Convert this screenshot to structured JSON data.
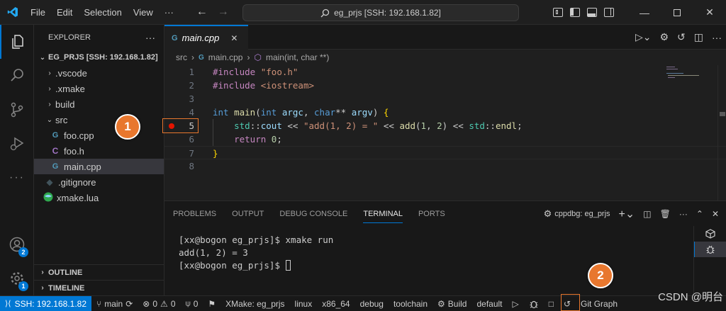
{
  "titlebar": {
    "menus": [
      "File",
      "Edit",
      "Selection",
      "View",
      "···"
    ],
    "command_center": "eg_prjs [SSH: 192.168.1.82]"
  },
  "activity": {
    "accounts_badge": "2",
    "manage_badge": "1"
  },
  "explorer": {
    "title": "EXPLORER",
    "root": "EG_PRJS [SSH: 192.168.1.82]",
    "items": [
      {
        "label": ".vscode",
        "type": "folder"
      },
      {
        "label": ".xmake",
        "type": "folder"
      },
      {
        "label": "build",
        "type": "folder"
      },
      {
        "label": "src",
        "type": "folder-open"
      },
      {
        "label": "foo.cpp",
        "type": "cpp"
      },
      {
        "label": "foo.h",
        "type": "h"
      },
      {
        "label": "main.cpp",
        "type": "cpp"
      },
      {
        "label": ".gitignore",
        "type": "git"
      },
      {
        "label": "xmake.lua",
        "type": "lua"
      }
    ],
    "outline": "OUTLINE",
    "timeline": "TIMELINE"
  },
  "editor": {
    "tab": "main.cpp",
    "breadcrumb": [
      "src",
      "main.cpp",
      "main(int, char **)"
    ],
    "line_numbers": [
      "1",
      "2",
      "3",
      "4",
      "5",
      "6",
      "7",
      "8"
    ],
    "breakpoint_line": "5"
  },
  "panel": {
    "tabs": [
      "PROBLEMS",
      "OUTPUT",
      "DEBUG CONSOLE",
      "TERMINAL",
      "PORTS"
    ],
    "active_tab": "TERMINAL",
    "terminal_name": "cppdbg: eg_prjs",
    "terminal_lines": [
      "[xx@bogon eg_prjs]$ xmake run",
      "add(1, 2) = 3",
      "[xx@bogon eg_prjs]$ "
    ]
  },
  "statusbar": {
    "remote": "SSH: 192.168.1.82",
    "branch": "main",
    "errors": "0",
    "warnings": "0",
    "ports": "0",
    "xmake": "XMake: eg_prjs",
    "platform": "linux",
    "arch": "x86_64",
    "mode": "debug",
    "toolchain": "toolchain",
    "build": "Build",
    "target": "default",
    "git_graph": "Git Graph"
  },
  "annotations": [
    "1",
    "2"
  ],
  "watermark": "CSDN @明台",
  "colors": {
    "accent": "#0078d4",
    "annotation": "#e8772e",
    "breakpoint": "#e51400"
  }
}
